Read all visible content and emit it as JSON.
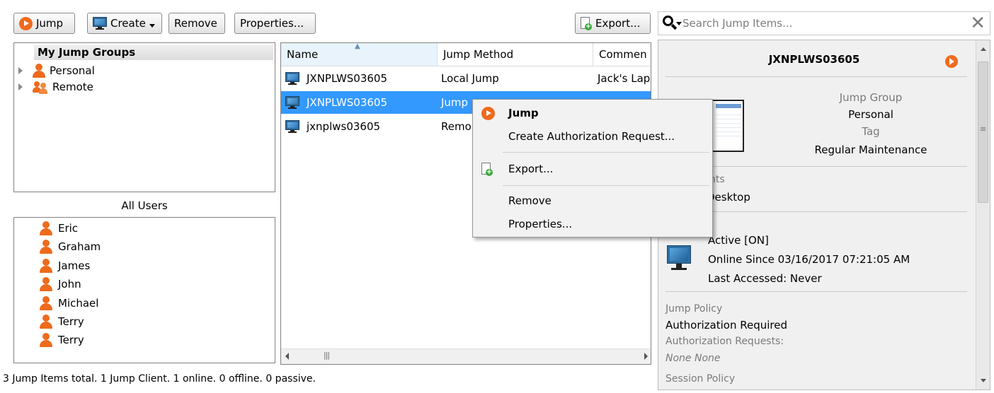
{
  "toolbar": {
    "jump_label": "Jump",
    "create_label": "Create",
    "remove_label": "Remove",
    "properties_label": "Properties...",
    "export_label": "Export..."
  },
  "search": {
    "placeholder": "Search Jump Items...",
    "clear_icon": "close-icon"
  },
  "groups": {
    "header": "My Jump Groups",
    "items": [
      {
        "label": "Personal",
        "icon": "user-icon"
      },
      {
        "label": "Remote",
        "icon": "users-icon"
      }
    ]
  },
  "users": {
    "header": "All Users",
    "items": [
      "Eric",
      "Graham",
      "James",
      "John",
      "Michael",
      "Terry",
      "Terry"
    ]
  },
  "list": {
    "columns": [
      "Name",
      "Jump Method",
      "Commen"
    ],
    "rows": [
      {
        "name": "JXNPLWS03605",
        "method": "Local Jump",
        "comment": "Jack's Lap",
        "selected": false
      },
      {
        "name": "JXNPLWS03605",
        "method": "Jump",
        "comment": "",
        "selected": true
      },
      {
        "name": "jxnplws03605",
        "method": "Remo",
        "comment": "",
        "selected": false
      }
    ]
  },
  "context_menu": {
    "items": [
      "Jump",
      "Create Authorization Request...",
      "Export...",
      "Remove",
      "Properties..."
    ]
  },
  "detail": {
    "title": "JXNPLWS03605",
    "jump_group_label": "Jump Group",
    "jump_group_value": "Personal",
    "tag_label": "Tag",
    "tag_value": "Regular Maintenance",
    "partial_label": "nts",
    "partial_value": "Desktop",
    "status_active": "Active [ON]",
    "online_since": "Online Since 03/16/2017 07:21:05 AM",
    "last_accessed": "Last Accessed: Never",
    "jump_policy_label": "Jump Policy",
    "jump_policy_value": "Authorization Required",
    "auth_requests_label": "Authorization Requests:",
    "auth_requests_value": "None None",
    "session_policy_label": "Session Policy"
  },
  "status_bar": {
    "text": "3 Jump Items total. 1 Jump Client. 1 online. 0 offline. 0 passive."
  },
  "colors": {
    "accent_orange": "#ef6a1e",
    "selection_blue": "#3399ff"
  }
}
